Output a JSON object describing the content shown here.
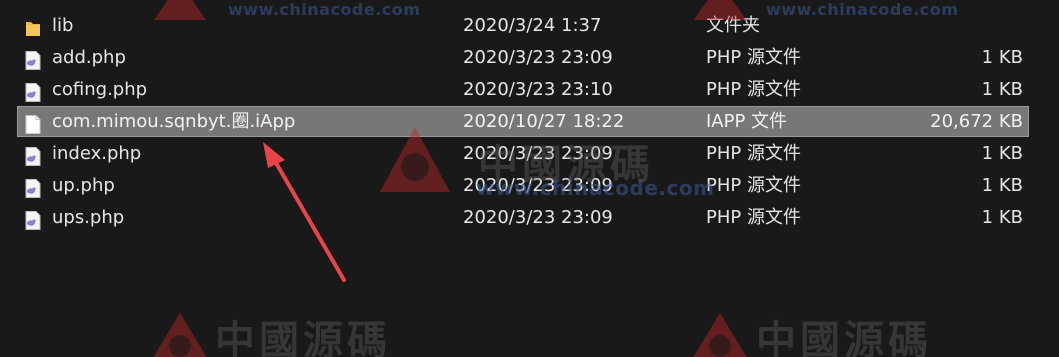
{
  "files": [
    {
      "name": "lib",
      "date": "2020/3/24 1:37",
      "type": "文件夹",
      "size": "",
      "icon": "folder-icon",
      "selected": false
    },
    {
      "name": "add.php",
      "date": "2020/3/23 23:09",
      "type": "PHP 源文件",
      "size": "1 KB",
      "icon": "php-file-icon",
      "selected": false
    },
    {
      "name": "cofing.php",
      "date": "2020/3/23 23:10",
      "type": "PHP 源文件",
      "size": "1 KB",
      "icon": "php-file-icon",
      "selected": false
    },
    {
      "name": "com.mimou.sqnbyt.圈.iApp",
      "date": "2020/10/27 18:22",
      "type": "IAPP 文件",
      "size": "20,672 KB",
      "icon": "blank-file-icon",
      "selected": true
    },
    {
      "name": "index.php",
      "date": "2020/3/23 23:09",
      "type": "PHP 源文件",
      "size": "1 KB",
      "icon": "php-file-icon",
      "selected": false
    },
    {
      "name": "up.php",
      "date": "2020/3/23 23:09",
      "type": "PHP 源文件",
      "size": "1 KB",
      "icon": "php-file-icon",
      "selected": false
    },
    {
      "name": "ups.php",
      "date": "2020/3/23 23:09",
      "type": "PHP 源文件",
      "size": "1 KB",
      "icon": "php-file-icon",
      "selected": false
    }
  ],
  "watermark": {
    "url": "www.chinacode.com",
    "chinese": "中國源碼"
  },
  "colors": {
    "background": "#191919",
    "selection": "#777777",
    "arrow": "#e8454a",
    "folder": "#e8b64a"
  }
}
